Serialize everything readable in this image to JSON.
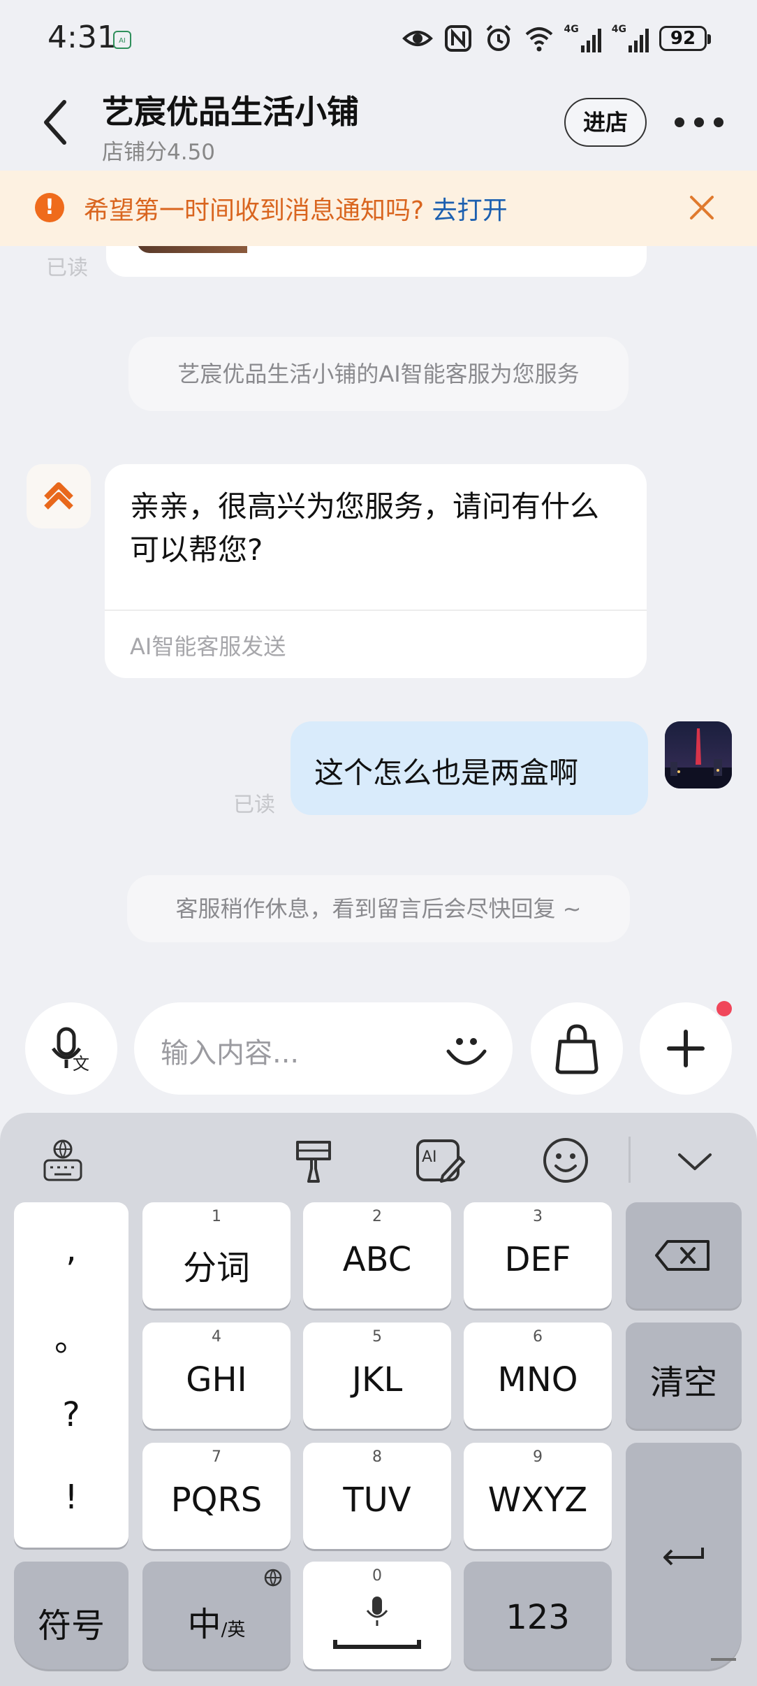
{
  "status_bar": {
    "time": "4:31",
    "net1": "4G",
    "net2": "4G",
    "battery": "92"
  },
  "header": {
    "shop_name": "艺宸优品生活小铺",
    "shop_score": "店铺分4.50",
    "enter_label": "进店"
  },
  "notice": {
    "text": "希望第一时间收到消息通知吗?",
    "link": "去打开"
  },
  "messages": {
    "prev_read": "已读",
    "system_1": "艺宸优品生活小铺的AI智能客服为您服务",
    "ai_text": "亲亲，很高兴为您服务，请问有什么可以帮您?",
    "ai_footer": "AI智能客服发送",
    "user_text": "这个怎么也是两盒啊",
    "user_read": "已读",
    "system_2": "客服稍作休息，看到留言后会尽快回复 ~"
  },
  "input": {
    "placeholder": "输入内容..."
  },
  "keyboard": {
    "punct": [
      ",",
      "。",
      "?",
      "!"
    ],
    "keys": [
      {
        "num": "1",
        "label": "分词"
      },
      {
        "num": "2",
        "label": "ABC"
      },
      {
        "num": "3",
        "label": "DEF"
      },
      {
        "num": "4",
        "label": "GHI"
      },
      {
        "num": "5",
        "label": "JKL"
      },
      {
        "num": "6",
        "label": "MNO"
      },
      {
        "num": "7",
        "label": "PQRS"
      },
      {
        "num": "8",
        "label": "TUV"
      },
      {
        "num": "9",
        "label": "WXYZ"
      }
    ],
    "clear_label": "清空",
    "symbol_label": "符号",
    "lang_main": "中",
    "lang_sub": "/英",
    "space_num": "0",
    "numeric_label": "123"
  },
  "colors": {
    "accent_orange": "#ef6b1c",
    "link_blue": "#1b5fb0",
    "user_bubble": "#d9ebfb",
    "notice_bg": "#fdf1e1"
  }
}
